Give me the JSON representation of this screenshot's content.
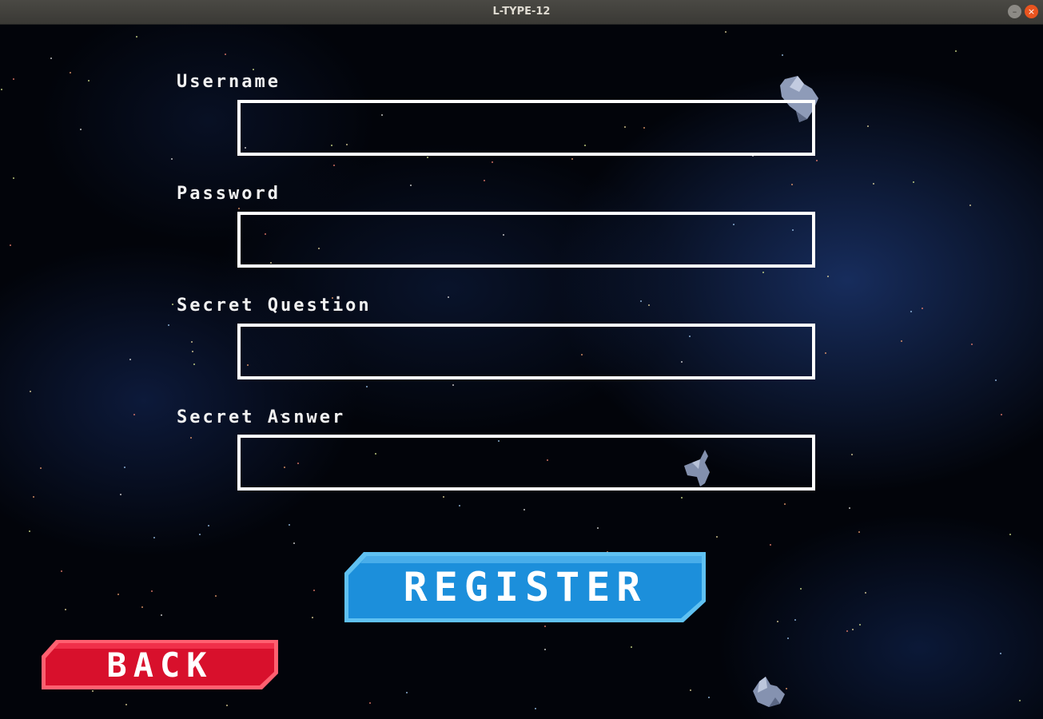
{
  "window": {
    "title": "L-TYPE-12",
    "minimize_glyph": "–",
    "close_glyph": "×"
  },
  "form": {
    "username_label": "Username",
    "username_value": "",
    "password_label": "Password",
    "password_value": "",
    "question_label": "Secret Question",
    "question_value": "",
    "answer_label": "Secret Asnwer",
    "answer_value": ""
  },
  "buttons": {
    "register_label": "REGISTER",
    "back_label": "BACK"
  },
  "colors": {
    "register_fill": "#1c8fdb",
    "register_border": "#5fc1f2",
    "back_fill": "#d8102c",
    "back_border": "#ff6070",
    "field_border": "#ffffff",
    "label_text": "#f1f1f1"
  },
  "decor": {
    "asteroid_icon": "asteroid-icon"
  }
}
